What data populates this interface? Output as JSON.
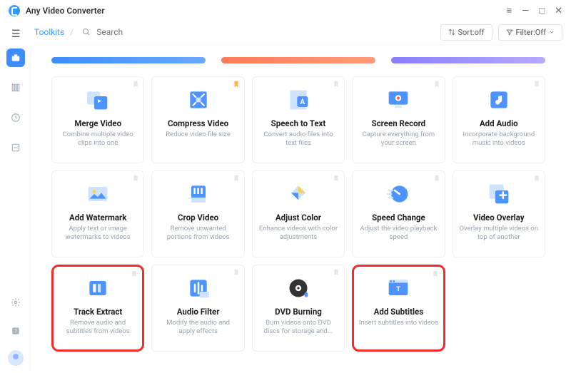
{
  "app": {
    "title": "Any Video Converter"
  },
  "breadcrumb": {
    "root": "Toolkits"
  },
  "search": {
    "placeholder": "Search"
  },
  "toolbar": {
    "sort": "Sort:off",
    "filter": "Filter:Off"
  },
  "colors": {
    "accent": "#3e8cff",
    "redHl": "#ef2b2b"
  },
  "tools": [
    {
      "id": "merge-video",
      "title": "Merge Video",
      "desc": "Combine multiple video clips into one",
      "bookmarked": false
    },
    {
      "id": "compress-video",
      "title": "Compress Video",
      "desc": "Reduce video file size",
      "bookmarked": true
    },
    {
      "id": "speech-to-text",
      "title": "Speech to Text",
      "desc": "Convert audio files into text files",
      "bookmarked": false
    },
    {
      "id": "screen-record",
      "title": "Screen Record",
      "desc": "Capture everything from your screen",
      "bookmarked": false
    },
    {
      "id": "add-audio",
      "title": "Add Audio",
      "desc": "Incorporate background music into videos",
      "bookmarked": false
    },
    {
      "id": "add-watermark",
      "title": "Add Watermark",
      "desc": "Apply text or image watermarks to videos",
      "bookmarked": false
    },
    {
      "id": "crop-video",
      "title": "Crop Video",
      "desc": "Remove unwanted portions from videos",
      "bookmarked": false
    },
    {
      "id": "adjust-color",
      "title": "Adjust Color",
      "desc": "Enhance videos with color adjustments",
      "bookmarked": false
    },
    {
      "id": "speed-change",
      "title": "Speed Change",
      "desc": "Adjust the video playback speed",
      "bookmarked": false
    },
    {
      "id": "video-overlay",
      "title": "Video Overlay",
      "desc": "Overlay multiple videos on top of another",
      "bookmarked": false
    },
    {
      "id": "track-extract",
      "title": "Track Extract",
      "desc": "Remove audio and subtitles from videos",
      "bookmarked": false,
      "highlight": true
    },
    {
      "id": "audio-filter",
      "title": "Audio Filter",
      "desc": "Modify the audio and apply effects",
      "bookmarked": false
    },
    {
      "id": "dvd-burning",
      "title": "DVD Burning",
      "desc": "Burn videos onto DVD discs for storage and...",
      "bookmarked": false
    },
    {
      "id": "add-subtitles",
      "title": "Add Subtitles",
      "desc": "Insert subtitles into videos",
      "bookmarked": false,
      "highlight": true
    }
  ]
}
